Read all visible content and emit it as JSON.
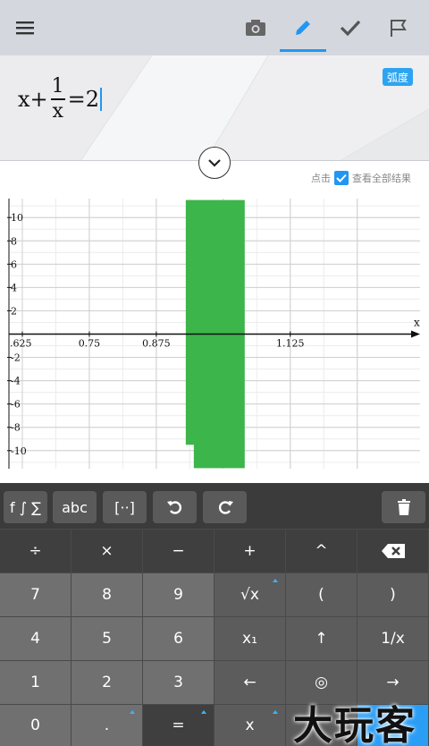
{
  "expression": {
    "prefix": "x+",
    "numerator": "1",
    "denominator": "x",
    "suffix": "=2",
    "mode_badge": "弧度"
  },
  "results_toggle": {
    "prefix": "点击",
    "label": "查看全部结果",
    "checked": true
  },
  "chart_data": {
    "type": "line",
    "x_label": "x",
    "x_ticks": [
      ".625",
      "0.75",
      "0.875",
      "1.125"
    ],
    "y_ticks": [
      "10",
      "8",
      "6",
      "4",
      "2",
      "-2",
      "-4",
      "-6",
      "-8",
      "-10"
    ],
    "xlim": [
      0.6,
      1.35
    ],
    "ylim": [
      -11.5,
      11.5
    ],
    "grid": true,
    "shaded_region": {
      "x_from": 0.93,
      "x_to": 1.04,
      "color": "#3cb54a"
    }
  },
  "toolbar": {
    "functions": "f ∫ ∑",
    "letters": "abc",
    "matrix": "[⋅⋅]"
  },
  "keys": {
    "row1": [
      "÷",
      "×",
      "−",
      "+",
      "^"
    ],
    "row2": [
      "7",
      "8",
      "9",
      "√x",
      "(",
      ")"
    ],
    "row3": [
      "4",
      "5",
      "6",
      "x₁",
      "↑",
      "1/x"
    ],
    "row4": [
      "1",
      "2",
      "3",
      "←",
      "◎",
      "→"
    ],
    "row5": [
      "0",
      ".",
      "=",
      "x"
    ]
  },
  "watermark": "大玩客",
  "colors": {
    "accent": "#2196f3",
    "graph_fill": "#3cb54a"
  }
}
